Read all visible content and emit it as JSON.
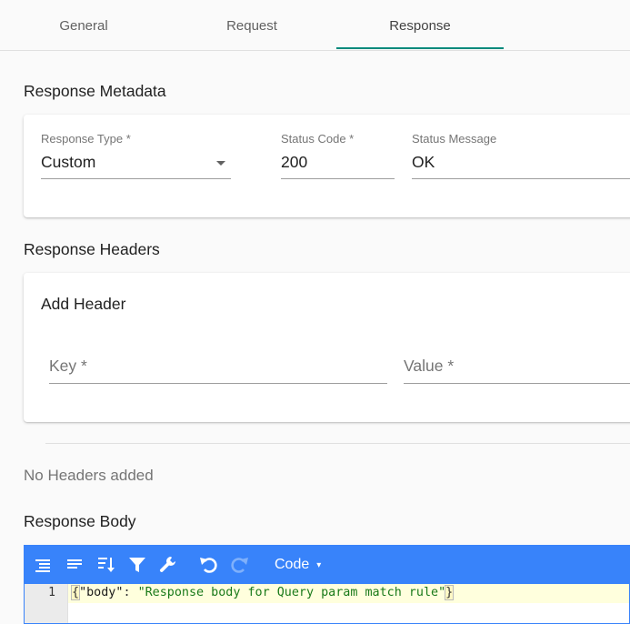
{
  "tabs": [
    {
      "label": "General"
    },
    {
      "label": "Request"
    },
    {
      "label": "Response"
    }
  ],
  "metadata": {
    "title": "Response Metadata",
    "response_type": {
      "label": "Response Type *",
      "value": "Custom"
    },
    "status_code": {
      "label": "Status Code *",
      "value": "200"
    },
    "status_message": {
      "label": "Status Message",
      "value": "OK"
    }
  },
  "headers": {
    "title": "Response Headers",
    "add_title": "Add Header",
    "key_placeholder": "Key *",
    "value_placeholder": "Value *",
    "empty_text": "No Headers added"
  },
  "body": {
    "title": "Response Body",
    "mode_label": "Code",
    "mode_arrow": "▾",
    "line_number": "1",
    "code": {
      "open_brace": "{",
      "key": "\"body\"",
      "colon": ": ",
      "value": "\"Response body for Query param match rule\"",
      "close_brace": "}"
    }
  },
  "colors": {
    "accent": "#00897b",
    "editor_menu": "#3883fa",
    "active_line": "#ffffdd"
  },
  "icons": [
    "format-icon",
    "compact-icon",
    "sort-icon",
    "filter-icon",
    "repair-icon",
    "undo-icon",
    "redo-icon"
  ]
}
